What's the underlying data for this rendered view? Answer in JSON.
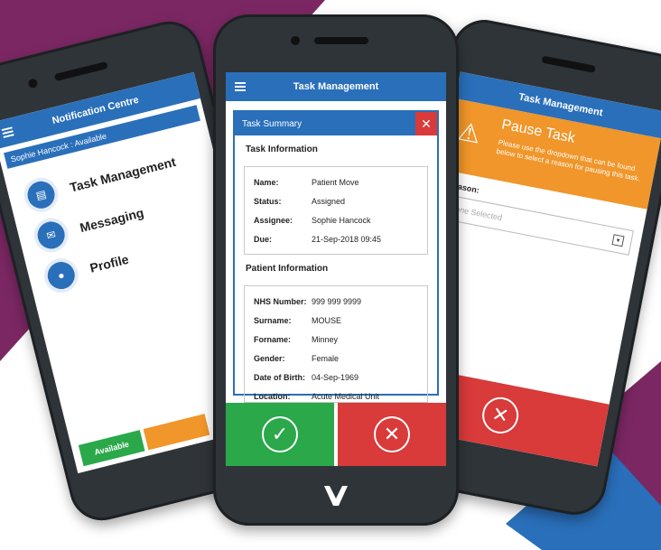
{
  "colors": {
    "brand_blue": "#2a6fba",
    "purple": "#7b2763",
    "orange": "#f0962a",
    "green": "#2aa84a",
    "red": "#d93a3a"
  },
  "left_phone": {
    "title": "Notification Centre",
    "user_status": "Sophie Hancock : Available",
    "items": [
      {
        "label": "Task Management",
        "icon": "clipboard-icon"
      },
      {
        "label": "Messaging",
        "icon": "message-icon"
      },
      {
        "label": "Profile",
        "icon": "person-icon"
      }
    ],
    "available_button": "Available"
  },
  "center_phone": {
    "title": "Task Management",
    "dialog_title": "Task Summary",
    "task_section": "Task Information",
    "task_rows": [
      {
        "k": "Name:",
        "v": "Patient Move"
      },
      {
        "k": "Status:",
        "v": "Assigned"
      },
      {
        "k": "Assignee:",
        "v": "Sophie Hancock"
      },
      {
        "k": "Due:",
        "v": "21-Sep-2018 09:45"
      }
    ],
    "patient_section": "Patient Information",
    "patient_rows": [
      {
        "k": "NHS Number:",
        "v": "999 999 9999"
      },
      {
        "k": "Surname:",
        "v": "MOUSE"
      },
      {
        "k": "Forname:",
        "v": "Minney"
      },
      {
        "k": "Gender:",
        "v": "Female"
      },
      {
        "k": "Date of Birth:",
        "v": "04-Sep-1969"
      },
      {
        "k": "Location:",
        "v": "Acute Medical Unit"
      }
    ]
  },
  "right_phone": {
    "title": "Task Management",
    "banner_title": "Pause Task",
    "banner_text": "Please use the dropdown that can be found below to select a reason for pausing this task.",
    "reason_label": "Reason:",
    "select_placeholder": "None Selected"
  }
}
